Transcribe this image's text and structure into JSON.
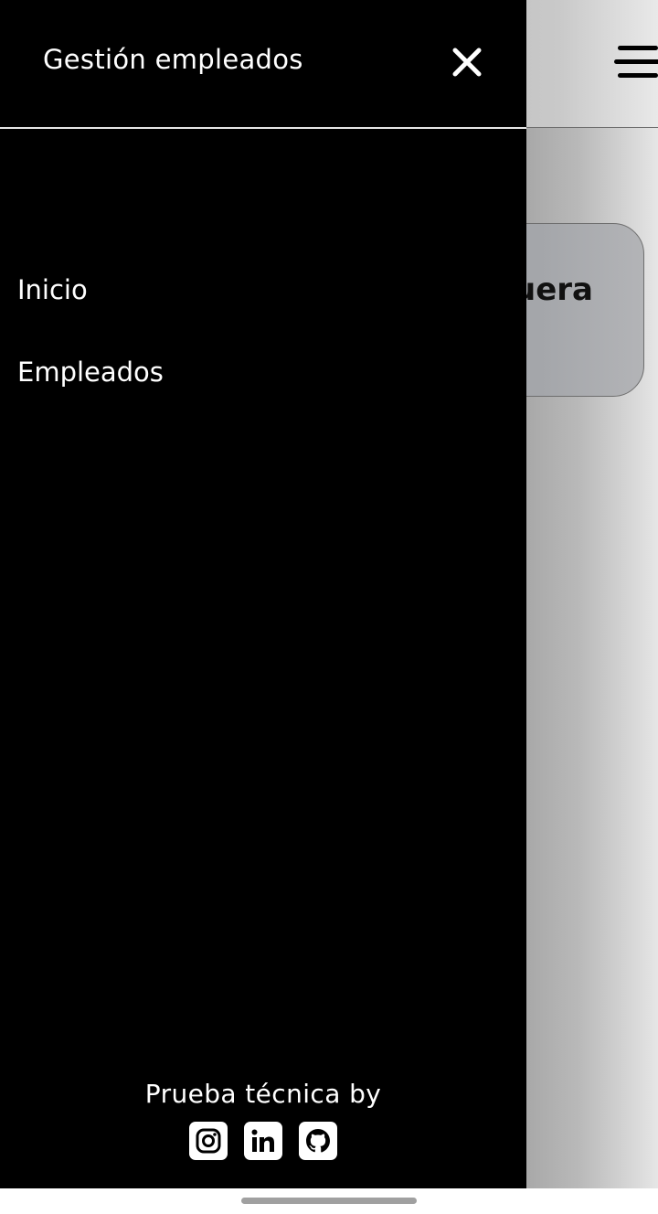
{
  "background_page": {
    "card_title_partial": "uera",
    "menu_icon": "hamburger-icon"
  },
  "drawer": {
    "title": "Gestión empleados",
    "close_icon": "close-icon",
    "nav_items": [
      {
        "label": "Inicio"
      },
      {
        "label": "Empleados"
      }
    ],
    "footer": {
      "text": "Prueba técnica by",
      "social_icons": [
        "instagram-icon",
        "linkedin-icon",
        "github-icon"
      ]
    }
  },
  "colors": {
    "drawer_bg": "#000000",
    "drawer_text": "#ffffff",
    "divider": "#e6e6e6"
  }
}
